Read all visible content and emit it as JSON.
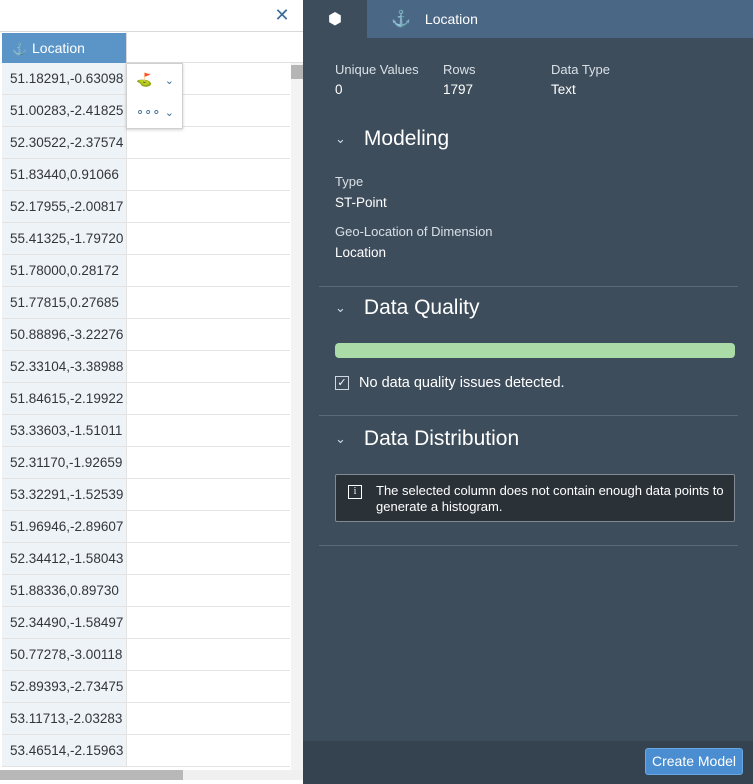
{
  "grid": {
    "close_icon": "close-icon",
    "column_header": "Location",
    "column_icon": "geo-location-icon",
    "rows": [
      "51.18291,-0.63098",
      "51.00283,-2.41825",
      "52.30522,-2.37574",
      "51.83440,0.91066",
      "52.17955,-2.00817",
      "55.41325,-1.79720",
      "51.78000,0.28172",
      "51.77815,0.27685",
      "50.88896,-3.22276",
      "52.33104,-3.38988",
      "51.84615,-2.19922",
      "53.33603,-1.51011",
      "52.31170,-1.92659",
      "53.32291,-1.52539",
      "51.96946,-2.89607",
      "52.34412,-1.58043",
      "51.88336,0.89730",
      "52.34490,-1.58497",
      "50.77278,-3.00118",
      "52.89393,-2.73475",
      "53.11713,-2.03283",
      "53.46514,-2.15963"
    ],
    "popup": {
      "action1_icon": "geo-enrich-icon",
      "action2_icon": "more-options-icon"
    }
  },
  "panel": {
    "tabs": {
      "cube_icon": "cube-icon",
      "location_icon": "geo-location-icon",
      "location_label": "Location"
    },
    "stats": {
      "unique_label": "Unique Values",
      "unique_value": "0",
      "rows_label": "Rows",
      "rows_value": "1797",
      "type_label": "Data Type",
      "type_value": "Text"
    },
    "modeling": {
      "title": "Modeling",
      "type_label": "Type",
      "type_value": "ST-Point",
      "geo_label": "Geo-Location of Dimension",
      "geo_value": "Location"
    },
    "quality": {
      "title": "Data Quality",
      "bar_fraction": 1.0,
      "bar_color": "#abdba6",
      "check_text": "No data quality issues detected."
    },
    "distribution": {
      "title": "Data Distribution",
      "message": "The selected column does not contain enough data points to generate a histogram."
    },
    "footer": {
      "create_label": "Create Model"
    }
  }
}
